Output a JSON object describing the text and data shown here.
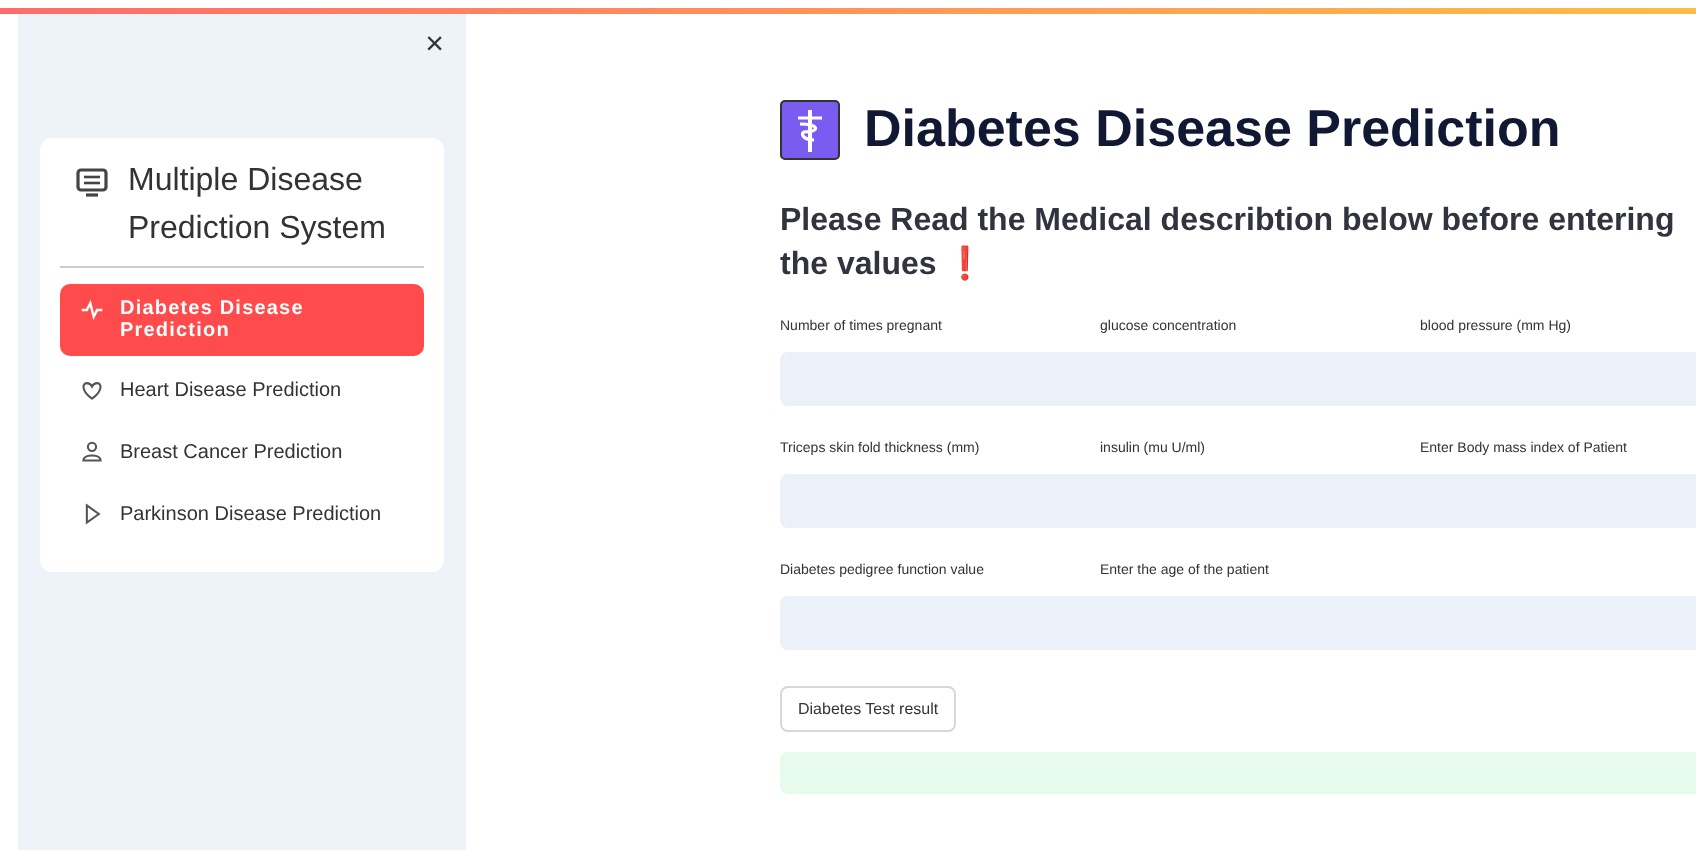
{
  "sidebar": {
    "close": "×",
    "title": "Multiple Disease Prediction System",
    "items": [
      {
        "label": "Diabetes Disease Prediction",
        "kind": "pulse",
        "selected": true
      },
      {
        "label": "Heart Disease Prediction",
        "kind": "heart",
        "selected": false
      },
      {
        "label": "Breast Cancer Prediction",
        "kind": "person",
        "selected": false
      },
      {
        "label": "Parkinson Disease Prediction",
        "kind": "play",
        "selected": false
      }
    ]
  },
  "main": {
    "title": "Diabetes Disease Prediction",
    "notice": "Please Read the Medical describtion below before entering the values",
    "notice_mark": "❗",
    "rows": [
      {
        "labels": [
          "Number of times pregnant",
          "glucose concentration",
          "blood pressure (mm Hg)"
        ]
      },
      {
        "labels": [
          "Triceps skin fold thickness (mm)",
          "insulin (mu U/ml)",
          "Enter Body mass index of Patient"
        ]
      },
      {
        "labels": [
          "Diabetes pedigree function value",
          "Enter the age of the patient"
        ]
      }
    ],
    "button": "Diabetes Test result",
    "result_bar": {
      "kind": "success"
    }
  }
}
